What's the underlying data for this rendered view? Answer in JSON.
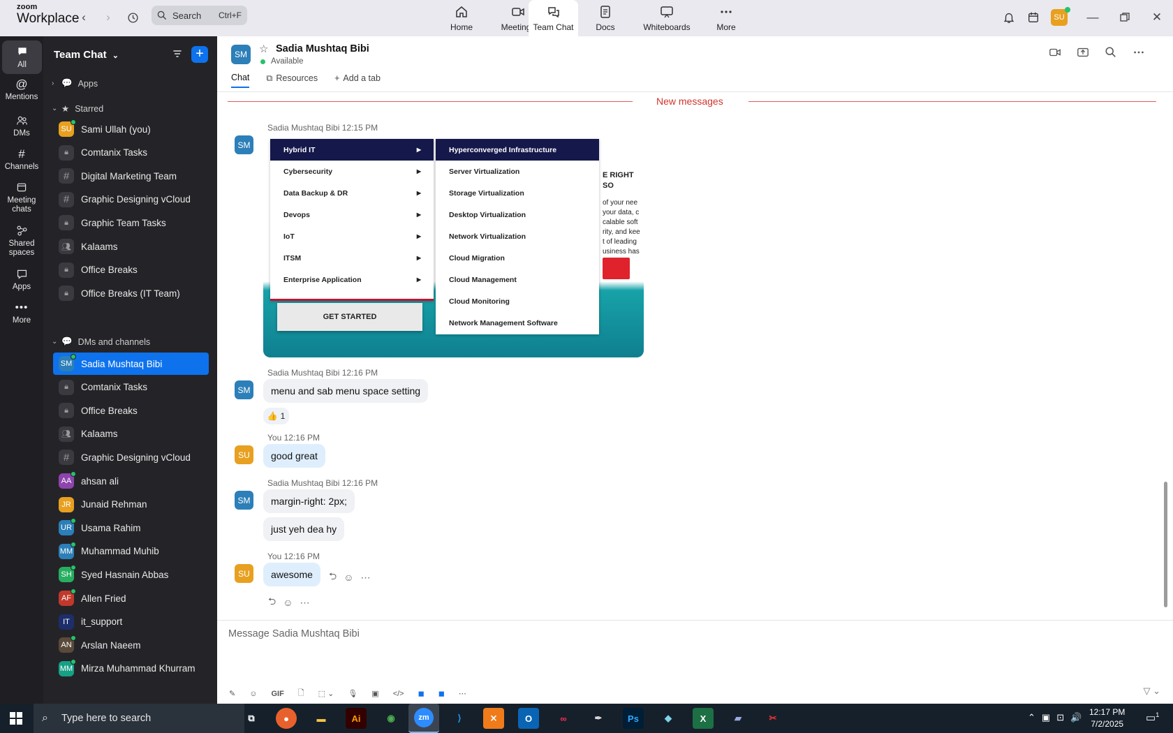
{
  "titlebar": {
    "brand_top": "zoom",
    "brand_bottom": "Workplace",
    "search_placeholder": "Search",
    "search_shortcut": "Ctrl+F",
    "tabs": [
      {
        "label": "Home",
        "icon": "home-icon"
      },
      {
        "label": "Meetings",
        "icon": "video-camera-icon"
      },
      {
        "label": "Team Chat",
        "icon": "chat-bubbles-icon",
        "active": true
      },
      {
        "label": "Docs",
        "icon": "document-icon"
      },
      {
        "label": "Whiteboards",
        "icon": "whiteboard-icon"
      },
      {
        "label": "More",
        "icon": "more-dots-icon"
      }
    ],
    "user_avatar": "SU"
  },
  "rail": {
    "items": [
      {
        "label": "All",
        "icon": "chat-icon"
      },
      {
        "label": "Mentions",
        "icon": "at-icon"
      },
      {
        "label": "DMs",
        "icon": "people-icon"
      },
      {
        "label": "Channels",
        "icon": "hash-icon"
      },
      {
        "label": "Meeting chats",
        "icon": "calendar-icon"
      },
      {
        "label": "Shared spaces",
        "icon": "shared-spaces-icon"
      },
      {
        "label": "Apps",
        "icon": "apps-icon"
      },
      {
        "label": "More",
        "icon": "more-dots-icon"
      }
    ]
  },
  "sidebar": {
    "title": "Team Chat",
    "sections": {
      "apps": "Apps",
      "starred": "Starred",
      "dms": "DMs and channels"
    },
    "starred": [
      {
        "label": "Sami Ullah (you)",
        "type": "avatar",
        "initials": "SU",
        "color": "#e8a020",
        "online": true
      },
      {
        "label": "Comtanix Tasks",
        "type": "lock"
      },
      {
        "label": "Digital Marketing Team",
        "type": "hash"
      },
      {
        "label": "Graphic Designing vCloud",
        "type": "hash"
      },
      {
        "label": "Graphic Team Tasks",
        "type": "lock"
      },
      {
        "label": "Kalaams",
        "type": "group"
      },
      {
        "label": "Office Breaks",
        "type": "lock"
      },
      {
        "label": "Office Breaks (IT Team)",
        "type": "lock"
      }
    ],
    "dms": [
      {
        "label": "Sadia Mushtaq Bibi",
        "type": "avatar",
        "initials": "SM",
        "color": "#2c7fb8",
        "online": true,
        "selected": true
      },
      {
        "label": "Comtanix Tasks",
        "type": "lock"
      },
      {
        "label": "Office Breaks",
        "type": "lock"
      },
      {
        "label": "Kalaams",
        "type": "group"
      },
      {
        "label": "Graphic Designing vCloud",
        "type": "hash"
      },
      {
        "label": "ahsan ali",
        "type": "avatar",
        "initials": "AA",
        "color": "#8e44ad",
        "online": true
      },
      {
        "label": "Junaid Rehman",
        "type": "avatar",
        "initials": "JR",
        "color": "#e8a020",
        "online": false
      },
      {
        "label": "Usama Rahim",
        "type": "avatar",
        "initials": "UR",
        "color": "#2c7fb8",
        "online": true
      },
      {
        "label": "Muhammad Muhib",
        "type": "avatar",
        "initials": "MM",
        "color": "#2c7fb8",
        "online": true
      },
      {
        "label": "Syed Hasnain Abbas",
        "type": "avatar",
        "initials": "SH",
        "color": "#27ae60",
        "online": true
      },
      {
        "label": "Allen Fried",
        "type": "avatar",
        "initials": "AF",
        "color": "#c0392b",
        "online": true
      },
      {
        "label": "it_support",
        "type": "avatar",
        "initials": "IT",
        "color": "#1d2e6b",
        "online": false
      },
      {
        "label": "Arslan Naeem",
        "type": "avatar",
        "initials": "AN",
        "color": "#5a4a3a",
        "online": true
      },
      {
        "label": "Mirza Muhammad Khurram",
        "type": "avatar",
        "initials": "MM",
        "color": "#16a085",
        "online": true
      }
    ]
  },
  "chat": {
    "contact_name": "Sadia Mushtaq Bibi",
    "contact_initials": "SM",
    "contact_status": "Available",
    "tabs": [
      "Chat",
      "Resources",
      "Add a tab"
    ],
    "new_messages_label": "New messages",
    "messages": [
      {
        "sender": "Sadia Mushtaq Bibi",
        "time": "12:15 PM"
      },
      {
        "sender": "Sadia Mushtaq Bibi",
        "time": "12:16 PM",
        "text": "menu and sab menu space setting",
        "reaction_emoji": "👍",
        "reaction_count": "1"
      },
      {
        "sender": "You",
        "time": "12:16 PM",
        "text": "good great"
      },
      {
        "sender": "Sadia Mushtaq Bibi",
        "time": "12:16 PM",
        "text": "margin-right: 2px;",
        "text2": "just yeh dea hy"
      },
      {
        "sender": "You",
        "time": "12:16 PM",
        "text": "awesome"
      }
    ],
    "screenshot": {
      "menu": [
        "Hybrid IT",
        "Cybersecurity",
        "Data Backup & DR",
        "Devops",
        "IoT",
        "ITSM",
        "Enterprise Application"
      ],
      "submenu": [
        "Hyperconverged Infrastructure",
        "Server Virtualization",
        "Storage Virtualization",
        "Desktop Virtualization",
        "Network Virtualization",
        "Cloud Migration",
        "Cloud Management",
        "Cloud Monitoring",
        "Network Management Software"
      ],
      "cta": "GET STARTED",
      "peek_heading": "E RIGHT SO",
      "peek_lines": [
        "of your nee",
        "your data, c",
        "calable soft",
        "rity, and kee",
        "t of leading",
        "usiness has"
      ]
    },
    "composer_placeholder": "Message Sadia Mushtaq Bibi"
  },
  "taskbar": {
    "search_placeholder": "Type here to search",
    "time": "12:17 PM",
    "date": "7/2/2025",
    "notification_count": "1"
  }
}
